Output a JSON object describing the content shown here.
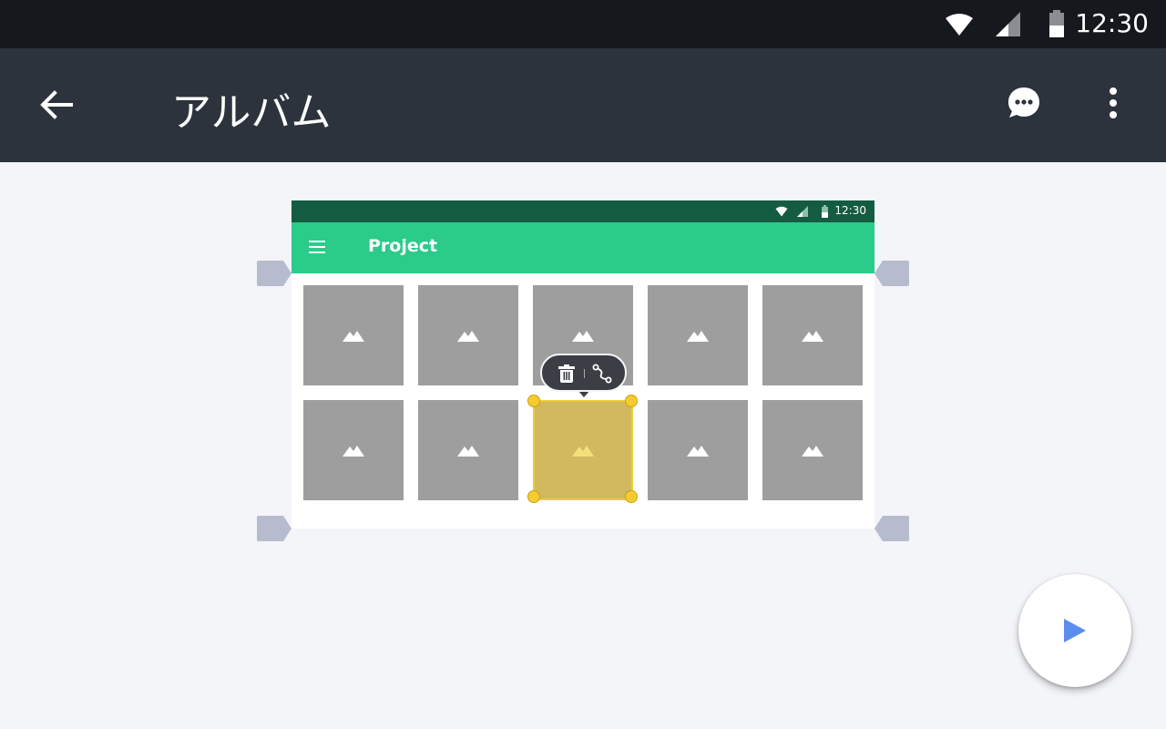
{
  "status_bar": {
    "time": "12:30",
    "icons": [
      "wifi-icon",
      "cellular-signal-icon",
      "battery-icon"
    ]
  },
  "app_bar": {
    "title": "アルバム",
    "back_icon": "arrow-back-icon",
    "actions": [
      "chat-bubble-icon",
      "more-vert-icon"
    ]
  },
  "preview": {
    "status_time": "12:30",
    "title": "Project",
    "menu_icon": "hamburger-menu-icon",
    "tiles": [
      {
        "icon": "image-placeholder-icon",
        "selected": false
      },
      {
        "icon": "image-placeholder-icon",
        "selected": false
      },
      {
        "icon": "image-placeholder-icon",
        "selected": false
      },
      {
        "icon": "image-placeholder-icon",
        "selected": false
      },
      {
        "icon": "image-placeholder-icon",
        "selected": false
      },
      {
        "icon": "image-placeholder-icon",
        "selected": false
      },
      {
        "icon": "image-placeholder-icon",
        "selected": false
      },
      {
        "icon": "image-placeholder-icon",
        "selected": true
      },
      {
        "icon": "image-placeholder-icon",
        "selected": false
      },
      {
        "icon": "image-placeholder-icon",
        "selected": false
      }
    ]
  },
  "selection_toolbar": {
    "actions": [
      "trash-icon",
      "connect-path-icon"
    ]
  },
  "fab": {
    "icon": "play-icon"
  },
  "colors": {
    "status_bar": "#15181d",
    "app_bar": "#2c333c",
    "canvas": "#f4f5f9",
    "preview_status": "#145c41",
    "preview_bar": "#2bcb8a",
    "tile": "#9e9e9e",
    "tile_selected": "#d0b95e",
    "selection_handle": "#f5cb2f",
    "fab_icon": "#5b8def"
  }
}
